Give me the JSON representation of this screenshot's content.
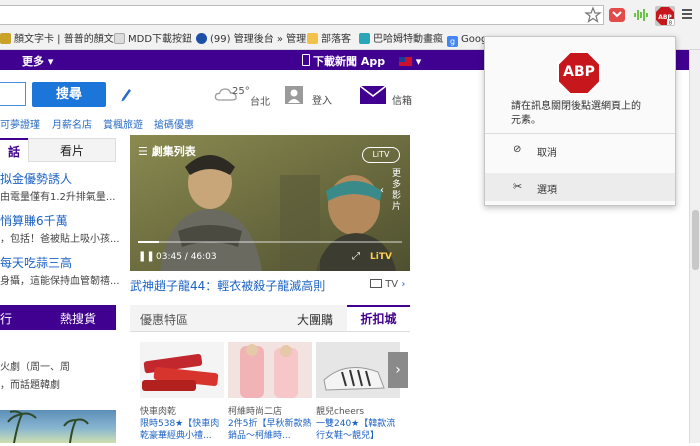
{
  "bookmarks": [
    {
      "label": "顏文字卡 | 普普的顏文",
      "color": "#c9a227"
    },
    {
      "label": "MDD下載按鈕",
      "color": "#dcdcdc"
    },
    {
      "label": "(99) 管理後台 » 管理",
      "color": "#1e4fa8"
    },
    {
      "label": "部落客",
      "color": "#f1c14a"
    },
    {
      "label": "巴哈姆特動畫瘋",
      "color": "#2aa6b8"
    },
    {
      "label": "Goog",
      "color": "#4285f4"
    }
  ],
  "yahoo_bar": {
    "more": "更多",
    "download_app": "下載新聞 App"
  },
  "search": {
    "button": "搜尋"
  },
  "weather": {
    "temp": "25°",
    "city": "台北"
  },
  "account": {
    "login": "登入",
    "mail": "信箱"
  },
  "sublinks": [
    "可夢證瑾",
    "月薪名店",
    "賞楓旅遊",
    "搶碼優惠"
  ],
  "left_tabs": [
    "話",
    "看片"
  ],
  "left_news": [
    {
      "title": "拟金優勢誘人",
      "desc": "由電量僅有1.2升排氣量..."
    },
    {
      "title": "悄算賺6千萬",
      "desc": "，包括！爸被貼上吸小孩..."
    },
    {
      "title": "每天吃蒜三高",
      "desc": "身攝，這能保持血管韌禧..."
    }
  ],
  "left_tabs2": [
    "行",
    "熱搜貨"
  ],
  "left_bottom": [
    "火劇（周一、周",
    "，而話題韓劇"
  ],
  "video": {
    "playlist": "劇集列表",
    "more": "更多影片",
    "time": "03:45 / 46:03",
    "brand": "LiTV",
    "caption": "武神趙子龍44：輕衣被殺子龍滅高則",
    "tv": "TV"
  },
  "deals": {
    "tabs": [
      "優惠特區",
      "大團購",
      "折扣城"
    ],
    "items": [
      {
        "shop": "快車肉乾",
        "title": "限時538★【快車肉乾豪華經典小禮..."
      },
      {
        "shop": "柯維時尚二店",
        "title": "2件5折【早秋新款熱銷品～柯維時..."
      },
      {
        "shop": "靚兒cheers",
        "title": "一雙240★【韓款流行女鞋～靚兒】"
      }
    ]
  },
  "abp_popup": {
    "logo": "ABP",
    "message": "請在訊息關閉後點選網頁上的元素。",
    "cancel": "取消",
    "options": "選項"
  },
  "colors": {
    "yahoo_purple": "#400090",
    "abp_red": "#c8161d",
    "link_blue": "#2b6cc4"
  }
}
